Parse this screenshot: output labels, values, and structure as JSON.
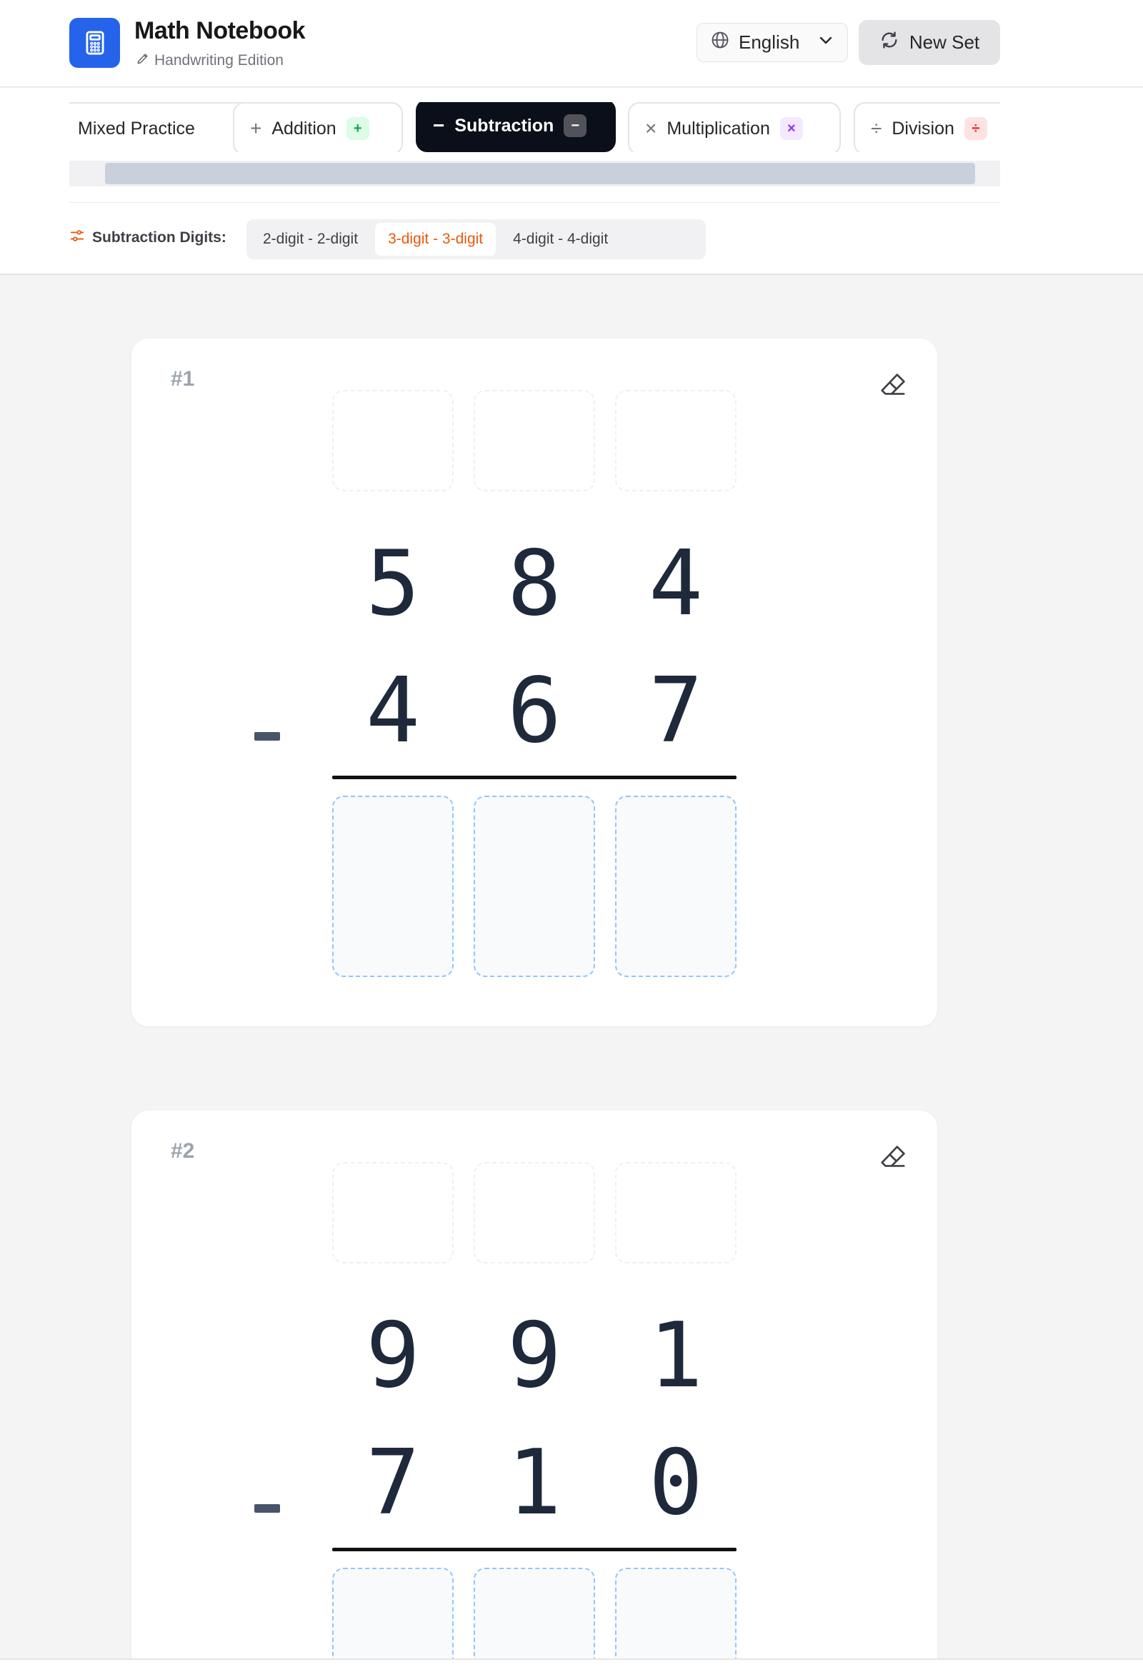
{
  "header": {
    "title": "Math Notebook",
    "subtitle": "Handwriting Edition",
    "language": "English",
    "new_set_label": "New Set",
    "icons": {
      "logo": "calculator-icon",
      "subtitle": "pencil-icon",
      "language": "globe-icon",
      "dropdown": "chevron-down-icon",
      "new_set": "refresh-icon"
    }
  },
  "tabs": [
    {
      "label": "Mixed Practice",
      "symbol": "",
      "pill": "",
      "pill_bg": "",
      "pill_fg": "",
      "active": false
    },
    {
      "label": "Addition",
      "symbol": "+",
      "pill": "+",
      "pill_bg": "#dcfce7",
      "pill_fg": "#16a34a",
      "active": false
    },
    {
      "label": "Subtraction",
      "symbol": "−",
      "pill": "−",
      "pill_bg": "#52525b",
      "pill_fg": "#ffffff",
      "active": true
    },
    {
      "label": "Multiplication",
      "symbol": "×",
      "pill": "×",
      "pill_bg": "#f3e8ff",
      "pill_fg": "#9333ea",
      "active": false
    },
    {
      "label": "Division",
      "symbol": "÷",
      "pill": "÷",
      "pill_bg": "#fee2e2",
      "pill_fg": "#dc2626",
      "active": false
    }
  ],
  "digits": {
    "label": "Subtraction Digits:",
    "options": [
      "2-digit - 2-digit",
      "3-digit - 3-digit",
      "4-digit - 4-digit"
    ],
    "selected": 1
  },
  "problems": [
    {
      "number": "#1",
      "top": [
        "5",
        "8",
        "4"
      ],
      "bottom": [
        "4",
        "6",
        "7"
      ],
      "operator": "-"
    },
    {
      "number": "#2",
      "top": [
        "9",
        "9",
        "1"
      ],
      "bottom": [
        "7",
        "1",
        "0"
      ],
      "operator": "-"
    }
  ],
  "colors": {
    "brand": "#2563eb",
    "active_tab": "#0b0f1a",
    "selected_option": "#ea580c",
    "answer_border": "#93c5fd"
  }
}
